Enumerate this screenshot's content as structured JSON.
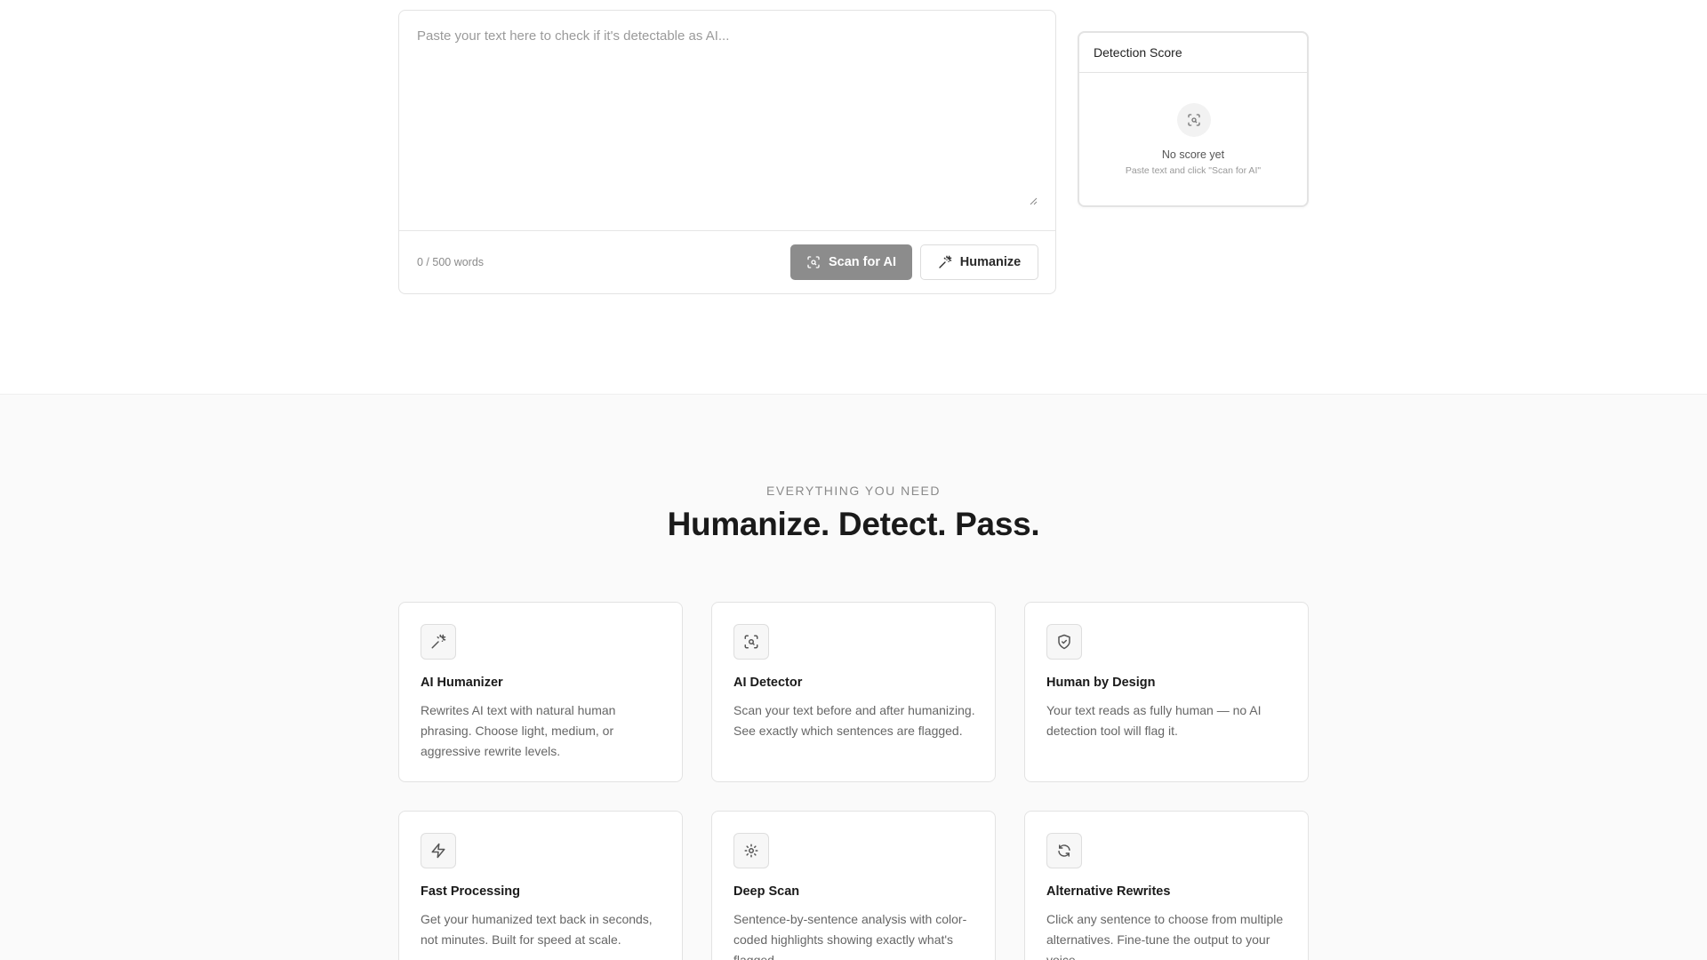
{
  "editor": {
    "placeholder": "Paste your text here to check if it's detectable as AI...",
    "word_count": "0 / 500 words",
    "scan_label": "Scan for AI",
    "humanize_label": "Humanize"
  },
  "score": {
    "title": "Detection Score",
    "empty_title": "No score yet",
    "empty_sub": "Paste text and click \"Scan for AI\""
  },
  "features": {
    "eyebrow": "EVERYTHING YOU NEED",
    "headline": "Humanize. Detect. Pass.",
    "items": [
      {
        "title": "AI Humanizer",
        "desc": "Rewrites AI text with natural human phrasing. Choose light, medium, or aggressive rewrite levels.",
        "icon": "sparkles-icon"
      },
      {
        "title": "AI Detector",
        "desc": "Scan your text before and after humanizing. See exactly which sentences are flagged.",
        "icon": "scan-search-icon"
      },
      {
        "title": "Human by Design",
        "desc": "Your text reads as fully human — no AI detection tool will flag it.",
        "icon": "shield-check-icon"
      },
      {
        "title": "Fast Processing",
        "desc": "Get your humanized text back in seconds, not minutes. Built for speed at scale.",
        "icon": "lightning-icon"
      },
      {
        "title": "Deep Scan",
        "desc": "Sentence-by-sentence analysis with color-coded highlights showing exactly what's flagged.",
        "icon": "sun-icon"
      },
      {
        "title": "Alternative Rewrites",
        "desc": "Click any sentence to choose from multiple alternatives. Fine-tune the output to your voice.",
        "icon": "refresh-icon"
      }
    ]
  },
  "colors": {
    "scan_button": "#8c8c8c",
    "section_bg": "#fafafa",
    "border": "#e3e3e3"
  }
}
